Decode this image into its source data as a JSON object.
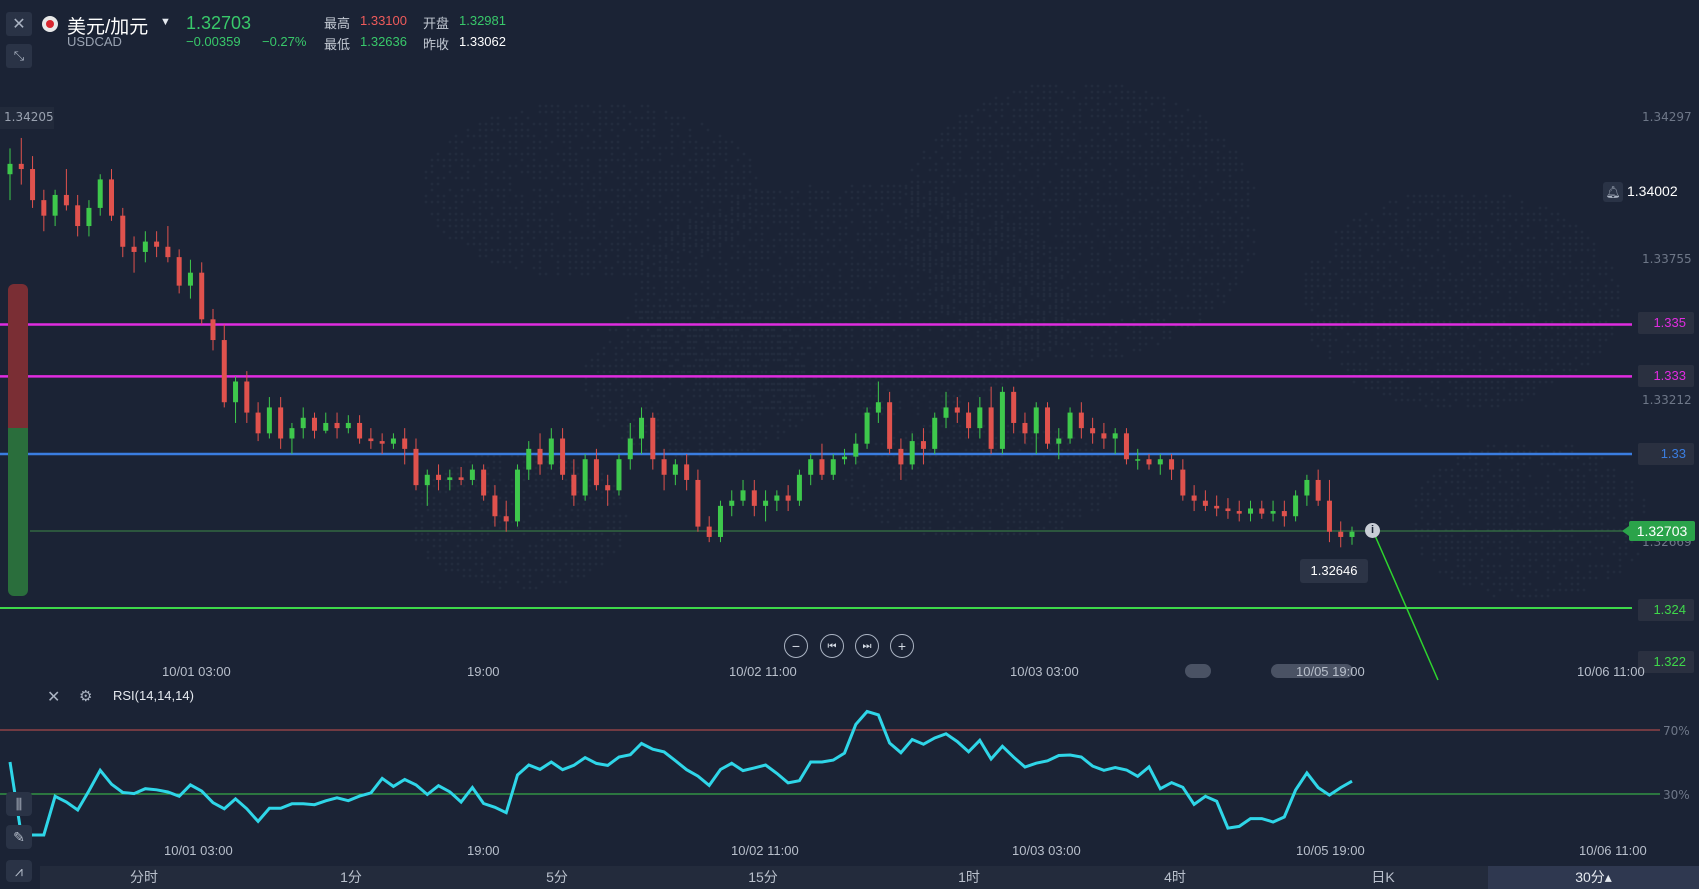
{
  "header": {
    "symbol_name": "美元/加元",
    "symbol_code": "USDCAD",
    "price": "1.32703",
    "change": "−0.00359",
    "change_pct": "−0.27%",
    "high_label": "最高",
    "high_value": "1.33100",
    "open_label": "开盘",
    "open_value": "1.32981",
    "low_label": "最低",
    "low_value": "1.32636",
    "prev_close_label": "昨收",
    "prev_close_value": "1.33062"
  },
  "price_axis": {
    "left_top": "1.34205",
    "right_labels": [
      "1.34297",
      "1.33755",
      "1.33212",
      "1.32669"
    ],
    "alert_price": "1.34002",
    "current_price": "1.32703",
    "low_tooltip": "1.32646"
  },
  "levels": [
    {
      "value": "1.335",
      "color": "#e02ce0"
    },
    {
      "value": "1.333",
      "color": "#e02ce0"
    },
    {
      "value": "1.33",
      "color": "#3a7de0"
    },
    {
      "value": "1.324",
      "color": "#3ed84a"
    },
    {
      "value": "1.322",
      "color": "#3ed84a"
    }
  ],
  "time_axis": {
    "labels": [
      "10/01 03:00",
      "19:00",
      "10/02 11:00",
      "10/03 03:00",
      "10/05 19:00",
      "10/06 11:00"
    ]
  },
  "rsi": {
    "title": "RSI(14,14,14)",
    "upper_label": "70%",
    "lower_label": "30%",
    "upper_color": "#c8504f",
    "lower_color": "#3ec84c",
    "line_color": "#2fd6e8",
    "time_labels": [
      "10/01 03:00",
      "19:00",
      "10/02 11:00",
      "10/03 03:00",
      "10/05 19:00",
      "10/06 11:00"
    ]
  },
  "tabs": [
    {
      "label": "分时",
      "active": false
    },
    {
      "label": "1分",
      "active": false
    },
    {
      "label": "5分",
      "active": false
    },
    {
      "label": "15分",
      "active": false
    },
    {
      "label": "1时",
      "active": false
    },
    {
      "label": "4时",
      "active": false
    },
    {
      "label": "日K",
      "active": false
    },
    {
      "label": "30分▴",
      "active": true
    }
  ],
  "chart_data": {
    "type": "candlestick",
    "title": "",
    "up_color": "#3ec84c",
    "down_color": "#e0524d",
    "ylim": [
      1.3205,
      1.3435
    ],
    "candles": [
      [
        1.3408,
        1.3418,
        1.3398,
        1.3412
      ],
      [
        1.3412,
        1.3422,
        1.3404,
        1.341
      ],
      [
        1.341,
        1.3415,
        1.3395,
        1.3398
      ],
      [
        1.3398,
        1.3402,
        1.3386,
        1.3392
      ],
      [
        1.3392,
        1.3402,
        1.3388,
        1.34
      ],
      [
        1.34,
        1.341,
        1.3394,
        1.3396
      ],
      [
        1.3396,
        1.34,
        1.3384,
        1.3388
      ],
      [
        1.3388,
        1.3398,
        1.3384,
        1.3395
      ],
      [
        1.3395,
        1.3408,
        1.3392,
        1.3406
      ],
      [
        1.3406,
        1.341,
        1.339,
        1.3392
      ],
      [
        1.3392,
        1.3395,
        1.3376,
        1.338
      ],
      [
        1.338,
        1.3384,
        1.337,
        1.3378
      ],
      [
        1.3378,
        1.3386,
        1.3374,
        1.3382
      ],
      [
        1.3382,
        1.3386,
        1.3376,
        1.338
      ],
      [
        1.338,
        1.3388,
        1.3374,
        1.3376
      ],
      [
        1.3376,
        1.3379,
        1.3362,
        1.3365
      ],
      [
        1.3365,
        1.3375,
        1.336,
        1.337
      ],
      [
        1.337,
        1.3374,
        1.335,
        1.3352
      ],
      [
        1.3352,
        1.3356,
        1.334,
        1.3344
      ],
      [
        1.3344,
        1.335,
        1.3318,
        1.332
      ],
      [
        1.332,
        1.333,
        1.3312,
        1.3328
      ],
      [
        1.3328,
        1.3332,
        1.3312,
        1.3316
      ],
      [
        1.3316,
        1.332,
        1.3305,
        1.3308
      ],
      [
        1.3308,
        1.3322,
        1.3306,
        1.3318
      ],
      [
        1.3318,
        1.3322,
        1.3302,
        1.3306
      ],
      [
        1.3306,
        1.3312,
        1.33,
        1.331
      ],
      [
        1.331,
        1.3318,
        1.3306,
        1.3314
      ],
      [
        1.3314,
        1.3316,
        1.3306,
        1.3309
      ],
      [
        1.3309,
        1.3316,
        1.3308,
        1.3312
      ],
      [
        1.3312,
        1.3316,
        1.3306,
        1.331
      ],
      [
        1.331,
        1.3315,
        1.3308,
        1.3312
      ],
      [
        1.3312,
        1.3315,
        1.3304,
        1.3306
      ],
      [
        1.3306,
        1.331,
        1.3302,
        1.3305
      ],
      [
        1.3305,
        1.3308,
        1.33,
        1.3304
      ],
      [
        1.3304,
        1.3308,
        1.3302,
        1.3306
      ],
      [
        1.3306,
        1.331,
        1.3296,
        1.3302
      ],
      [
        1.3302,
        1.3306,
        1.3286,
        1.3288
      ],
      [
        1.3288,
        1.3294,
        1.328,
        1.3292
      ],
      [
        1.3292,
        1.3296,
        1.3286,
        1.329
      ],
      [
        1.329,
        1.3294,
        1.3286,
        1.3291
      ],
      [
        1.3291,
        1.3295,
        1.3288,
        1.329
      ],
      [
        1.329,
        1.3296,
        1.3288,
        1.3294
      ],
      [
        1.3294,
        1.3296,
        1.3282,
        1.3284
      ],
      [
        1.3284,
        1.3288,
        1.3272,
        1.3276
      ],
      [
        1.3276,
        1.3282,
        1.327,
        1.3274
      ],
      [
        1.3274,
        1.3296,
        1.3272,
        1.3294
      ],
      [
        1.3294,
        1.3305,
        1.329,
        1.3302
      ],
      [
        1.3302,
        1.3308,
        1.3292,
        1.3296
      ],
      [
        1.3296,
        1.331,
        1.3294,
        1.3306
      ],
      [
        1.3306,
        1.331,
        1.329,
        1.3292
      ],
      [
        1.3292,
        1.3298,
        1.328,
        1.3284
      ],
      [
        1.3284,
        1.33,
        1.3282,
        1.3298
      ],
      [
        1.3298,
        1.3302,
        1.3286,
        1.3288
      ],
      [
        1.3288,
        1.3292,
        1.328,
        1.3286
      ],
      [
        1.3286,
        1.33,
        1.3284,
        1.3298
      ],
      [
        1.3298,
        1.3312,
        1.3294,
        1.3306
      ],
      [
        1.3306,
        1.3318,
        1.33,
        1.3314
      ],
      [
        1.3314,
        1.3316,
        1.3294,
        1.3298
      ],
      [
        1.3298,
        1.3302,
        1.3286,
        1.3292
      ],
      [
        1.3292,
        1.3298,
        1.3288,
        1.3296
      ],
      [
        1.3296,
        1.33,
        1.3286,
        1.329
      ],
      [
        1.329,
        1.3294,
        1.327,
        1.3272
      ],
      [
        1.3272,
        1.3276,
        1.3266,
        1.3268
      ],
      [
        1.3268,
        1.3282,
        1.3266,
        1.328
      ],
      [
        1.328,
        1.3286,
        1.3276,
        1.3282
      ],
      [
        1.3282,
        1.329,
        1.328,
        1.3286
      ],
      [
        1.3286,
        1.329,
        1.3276,
        1.328
      ],
      [
        1.328,
        1.3286,
        1.3274,
        1.3282
      ],
      [
        1.3282,
        1.3286,
        1.3278,
        1.3284
      ],
      [
        1.3284,
        1.3288,
        1.3278,
        1.3282
      ],
      [
        1.3282,
        1.3294,
        1.328,
        1.3292
      ],
      [
        1.3292,
        1.33,
        1.3288,
        1.3298
      ],
      [
        1.3298,
        1.3304,
        1.329,
        1.3292
      ],
      [
        1.3292,
        1.33,
        1.329,
        1.3298
      ],
      [
        1.3298,
        1.3302,
        1.3296,
        1.3299
      ],
      [
        1.3299,
        1.3308,
        1.3296,
        1.3304
      ],
      [
        1.3304,
        1.3318,
        1.3302,
        1.3316
      ],
      [
        1.3316,
        1.3328,
        1.3312,
        1.332
      ],
      [
        1.332,
        1.3324,
        1.33,
        1.3302
      ],
      [
        1.3302,
        1.3306,
        1.329,
        1.3296
      ],
      [
        1.3296,
        1.3308,
        1.3294,
        1.3305
      ],
      [
        1.3305,
        1.331,
        1.3296,
        1.3302
      ],
      [
        1.3302,
        1.3316,
        1.33,
        1.3314
      ],
      [
        1.3314,
        1.3324,
        1.331,
        1.3318
      ],
      [
        1.3318,
        1.3322,
        1.3312,
        1.3316
      ],
      [
        1.3316,
        1.332,
        1.3306,
        1.331
      ],
      [
        1.331,
        1.3322,
        1.3306,
        1.3318
      ],
      [
        1.3318,
        1.3326,
        1.33,
        1.3302
      ],
      [
        1.3302,
        1.3326,
        1.33,
        1.3324
      ],
      [
        1.3324,
        1.3326,
        1.3308,
        1.3312
      ],
      [
        1.3312,
        1.3316,
        1.3304,
        1.3308
      ],
      [
        1.3308,
        1.332,
        1.33,
        1.3318
      ],
      [
        1.3318,
        1.332,
        1.3302,
        1.3304
      ],
      [
        1.3304,
        1.331,
        1.3298,
        1.3306
      ],
      [
        1.3306,
        1.3318,
        1.3304,
        1.3316
      ],
      [
        1.3316,
        1.332,
        1.3306,
        1.331
      ],
      [
        1.331,
        1.3314,
        1.3304,
        1.3308
      ],
      [
        1.3308,
        1.3312,
        1.3302,
        1.3306
      ],
      [
        1.3306,
        1.331,
        1.33,
        1.3308
      ],
      [
        1.3308,
        1.331,
        1.3296,
        1.3298
      ],
      [
        1.3298,
        1.3302,
        1.3294,
        1.3298
      ],
      [
        1.3298,
        1.33,
        1.3294,
        1.3296
      ],
      [
        1.3296,
        1.33,
        1.3292,
        1.3298
      ],
      [
        1.3298,
        1.33,
        1.329,
        1.3294
      ],
      [
        1.3294,
        1.3298,
        1.3282,
        1.3284
      ],
      [
        1.3284,
        1.3288,
        1.3278,
        1.3282
      ],
      [
        1.3282,
        1.3286,
        1.3278,
        1.328
      ],
      [
        1.328,
        1.3284,
        1.3276,
        1.3279
      ],
      [
        1.3279,
        1.3283,
        1.3275,
        1.3278
      ],
      [
        1.3278,
        1.3282,
        1.3274,
        1.3277
      ],
      [
        1.3277,
        1.3282,
        1.3274,
        1.3279
      ],
      [
        1.3279,
        1.3282,
        1.3275,
        1.3277
      ],
      [
        1.3277,
        1.3282,
        1.3274,
        1.3278
      ],
      [
        1.3278,
        1.3282,
        1.3272,
        1.3276
      ],
      [
        1.3276,
        1.3286,
        1.3274,
        1.3284
      ],
      [
        1.3284,
        1.3292,
        1.328,
        1.329
      ],
      [
        1.329,
        1.3294,
        1.328,
        1.3282
      ],
      [
        1.3282,
        1.329,
        1.3266,
        1.327
      ],
      [
        1.327,
        1.3274,
        1.3264,
        1.3268
      ],
      [
        1.3268,
        1.3272,
        1.3265,
        1.327
      ]
    ]
  }
}
